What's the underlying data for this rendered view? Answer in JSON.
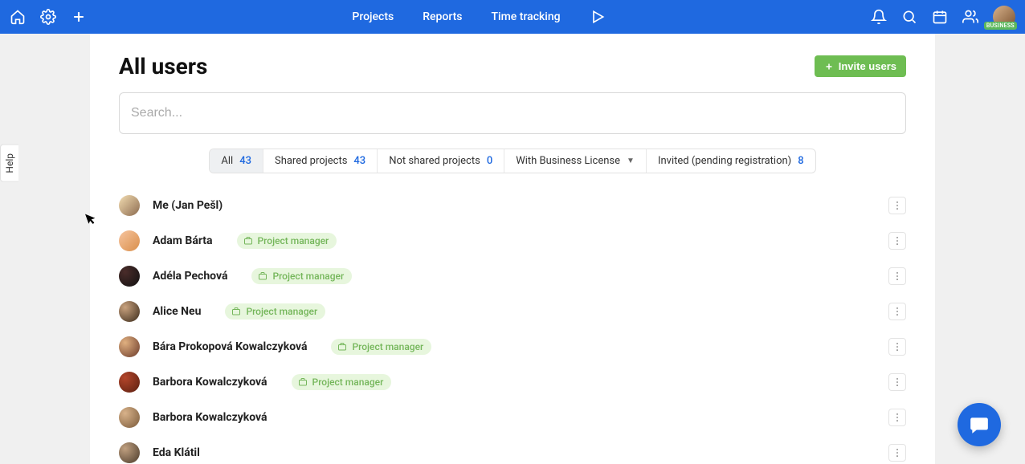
{
  "topbar": {
    "nav": {
      "projects": "Projects",
      "reports": "Reports",
      "time_tracking": "Time tracking"
    },
    "business_badge": "BUSINESS"
  },
  "help_tab": "Help",
  "page": {
    "title": "All users",
    "invite_label": "Invite users",
    "search_placeholder": "Search..."
  },
  "filters": {
    "all": {
      "label": "All",
      "count": "43"
    },
    "shared": {
      "label": "Shared projects",
      "count": "43"
    },
    "not_shared": {
      "label": "Not shared projects",
      "count": "0"
    },
    "with_license": {
      "label": "With Business License"
    },
    "invited": {
      "label": "Invited (pending registration)",
      "count": "8"
    }
  },
  "role_label": "Project manager",
  "users": [
    {
      "name": "Me (Jan Pešl)",
      "role": null,
      "av": "av1"
    },
    {
      "name": "Adam Bárta",
      "role": true,
      "av": "av2"
    },
    {
      "name": "Adéla Pechová",
      "role": true,
      "av": "av3"
    },
    {
      "name": "Alice Neu",
      "role": true,
      "av": "av4"
    },
    {
      "name": "Bára Prokopová Kowalczyková",
      "role": true,
      "av": "av5"
    },
    {
      "name": "Barbora Kowalczyková",
      "role": true,
      "av": "av6"
    },
    {
      "name": "Barbora Kowalczyková",
      "role": null,
      "av": "av7"
    },
    {
      "name": "Eda Klátil",
      "role": null,
      "av": "av8"
    }
  ]
}
